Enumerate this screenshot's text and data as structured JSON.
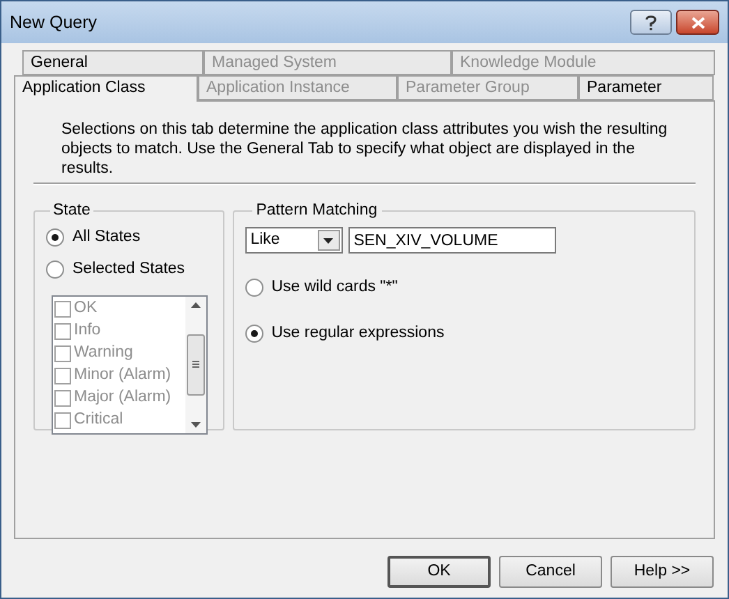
{
  "window": {
    "title": "New Query"
  },
  "tab_rows": [
    {
      "tabs": [
        {
          "label": "General",
          "selected": false,
          "disabled": false
        },
        {
          "label": "Managed System",
          "selected": false,
          "disabled": true
        },
        {
          "label": "Knowledge Module",
          "selected": false,
          "disabled": true
        }
      ]
    },
    {
      "tabs": [
        {
          "label": "Application Class",
          "selected": true,
          "disabled": false
        },
        {
          "label": "Application Instance",
          "selected": false,
          "disabled": true
        },
        {
          "label": "Parameter Group",
          "selected": false,
          "disabled": true
        },
        {
          "label": "Parameter",
          "selected": false,
          "disabled": false
        }
      ]
    }
  ],
  "description": "Selections on this tab determine the application class attributes you wish the resulting objects to match. Use the General Tab to specify what object are displayed in the results.",
  "state_group": {
    "title": "State",
    "options": [
      {
        "label": "All States",
        "selected": true
      },
      {
        "label": "Selected States",
        "selected": false
      }
    ],
    "list_disabled": true,
    "items": [
      {
        "label": "OK",
        "checked": false
      },
      {
        "label": "Info",
        "checked": false
      },
      {
        "label": "Warning",
        "checked": false
      },
      {
        "label": "Minor (Alarm)",
        "checked": false
      },
      {
        "label": "Major (Alarm)",
        "checked": false
      },
      {
        "label": "Critical",
        "checked": false
      }
    ]
  },
  "pattern_group": {
    "title": "Pattern Matching",
    "operator": "Like",
    "value": "SEN_XIV_VOLUME",
    "options": [
      {
        "label": "Use wild cards \"*\"",
        "selected": false
      },
      {
        "label": "Use regular expressions",
        "selected": true
      }
    ]
  },
  "buttons": [
    "OK",
    "Cancel",
    "Help >>"
  ]
}
